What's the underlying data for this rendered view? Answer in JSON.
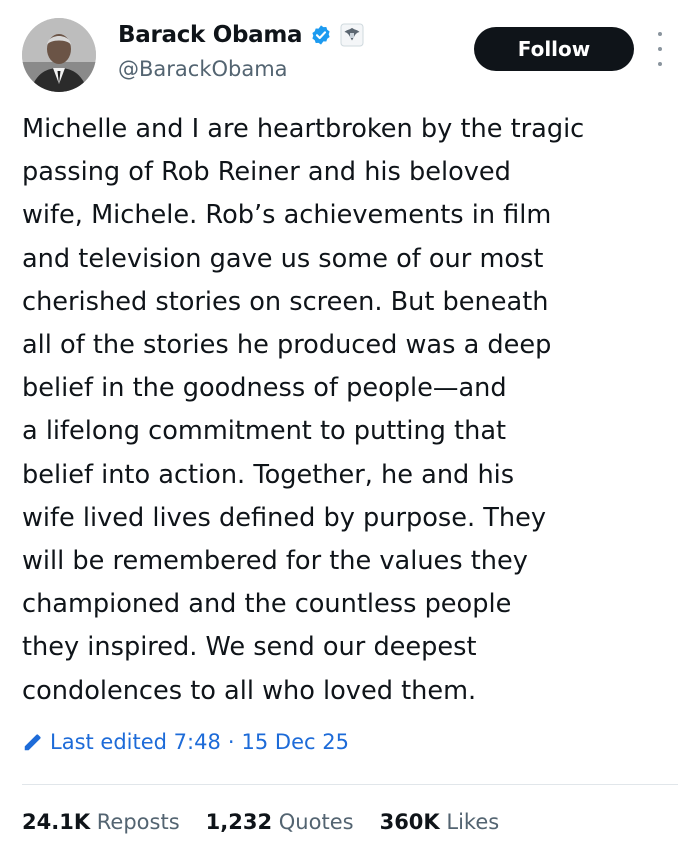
{
  "author": {
    "name": "Barack Obama",
    "handle": "@BarackObama"
  },
  "actions": {
    "follow_label": "Follow"
  },
  "tweet": {
    "lines": [
      "Michelle and I are heartbroken by the tragic",
      "passing of Rob Reiner and his beloved",
      "wife, Michele. Rob’s achievements in film",
      "and television gave us some of our most",
      "cherished stories on screen. But beneath",
      "all of the stories he produced was a deep",
      "belief in the goodness of people—and",
      "a lifelong commitment to putting that",
      "belief into action. Together, he and his",
      "wife lived lives defined by purpose. They",
      "will be remembered for the values they",
      "championed and the countless people",
      "they inspired. We send our deepest",
      "condolences to all who loved them."
    ]
  },
  "meta": {
    "edited_label": "Last edited 7:48",
    "separator": "·",
    "date": "15 Dec 25"
  },
  "stats": {
    "reposts_count": "24.1K",
    "reposts_label": "Reposts",
    "quotes_count": "1,232",
    "quotes_label": "Quotes",
    "likes_count": "360K",
    "likes_label": "Likes"
  },
  "icons": {
    "verified": "verified-badge-icon",
    "affiliation": "government-seal-icon",
    "edited": "pencil-icon",
    "more": "more-vertical-icon"
  },
  "colors": {
    "verified": "#1d9bf0",
    "link": "#1d6bd8",
    "button_bg": "#0f1419",
    "secondary_text": "#536471"
  }
}
